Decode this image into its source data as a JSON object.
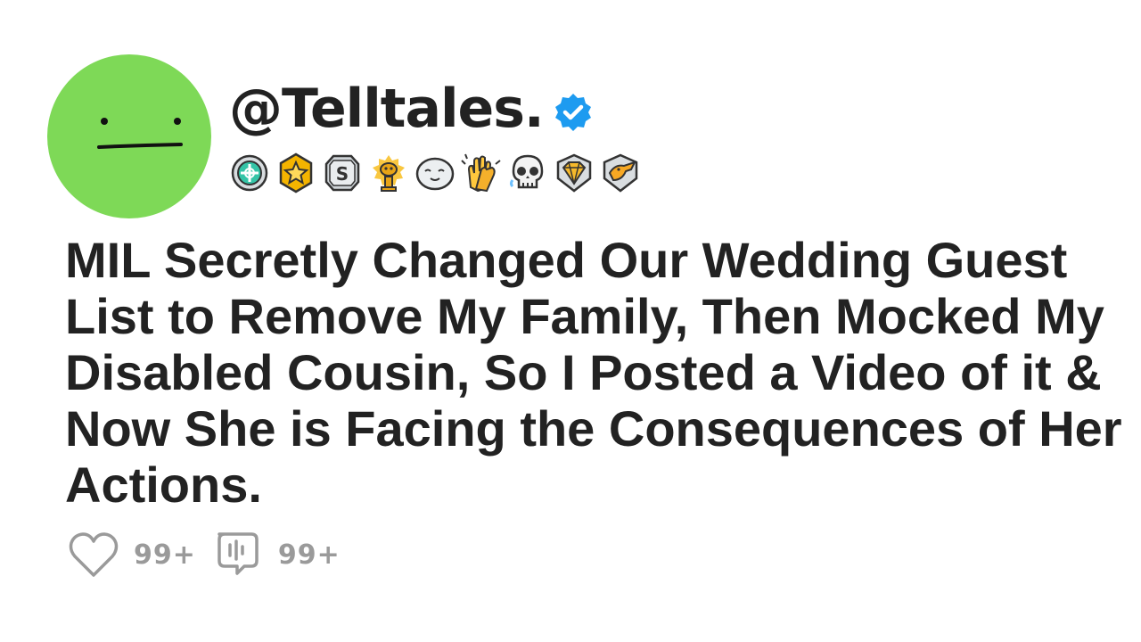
{
  "profile": {
    "username": "@Telltales.",
    "verified": true,
    "avatar_color": "#7ed957"
  },
  "awards": [
    {
      "icon": "helper-award-icon"
    },
    {
      "icon": "gold-star-award-icon"
    },
    {
      "icon": "silver-s-award-icon"
    },
    {
      "icon": "gold-snoo-award-icon"
    },
    {
      "icon": "seal-award-icon"
    },
    {
      "icon": "clapping-hands-award-icon"
    },
    {
      "icon": "skull-award-icon"
    },
    {
      "icon": "gold-gem-award-icon"
    },
    {
      "icon": "duck-award-icon"
    }
  ],
  "post": {
    "title": "MIL Secretly Changed Our Wedding Guest List to Remove My Family, Then Mocked My Disabled Cousin, So I Posted a Video of it & Now She is Facing the Consequences of Her Actions."
  },
  "stats": {
    "likes": "99+",
    "comments": "99+"
  },
  "colors": {
    "verified_blue": "#1d9bf0",
    "stat_grey": "#9a9a9a",
    "text": "#222222"
  }
}
